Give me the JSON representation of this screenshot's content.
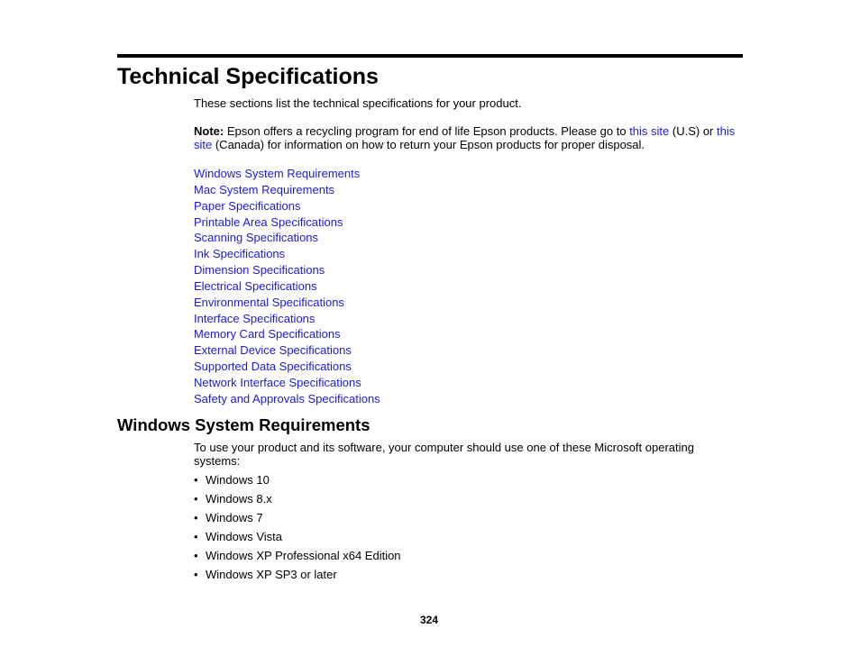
{
  "page": {
    "title": "Technical Specifications",
    "intro": "These sections list the technical specifications for your product.",
    "note": {
      "label": "Note:",
      "text_before": " Epson offers a recycling program for end of life Epson products. Please go to ",
      "link1": "this site",
      "text_middle": " (U.S) or ",
      "link2": "this site",
      "text_after": " (Canada) for information on how to return your Epson products for proper disposal."
    },
    "toc": [
      "Windows System Requirements",
      "Mac System Requirements",
      "Paper Specifications",
      "Printable Area Specifications",
      "Scanning Specifications",
      "Ink Specifications",
      "Dimension Specifications",
      "Electrical Specifications",
      "Environmental Specifications",
      "Interface Specifications",
      "Memory Card Specifications",
      "External Device Specifications",
      "Supported Data Specifications",
      "Network Interface Specifications",
      "Safety and Approvals Specifications"
    ],
    "section": {
      "title": "Windows System Requirements",
      "text": "To use your product and its software, your computer should use one of these Microsoft operating systems:",
      "bullet_glyph": "•",
      "items": [
        "Windows 10",
        "Windows 8.x",
        "Windows 7",
        "Windows Vista",
        "Windows XP Professional x64 Edition",
        "Windows XP SP3 or later"
      ]
    },
    "page_number": "324",
    "colors": {
      "link": "#1a1adc",
      "text": "#000000"
    }
  }
}
